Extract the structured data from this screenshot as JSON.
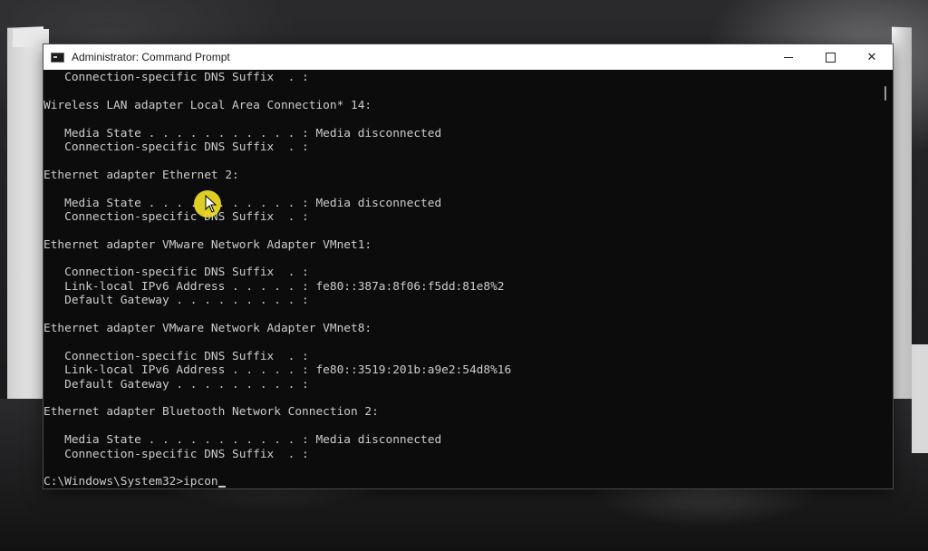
{
  "window": {
    "title": "Administrator: Command Prompt",
    "app_icon": "cmd-icon",
    "controls": {
      "minimize_icon": "minimize-icon",
      "maximize_icon": "maximize-icon",
      "close_glyph": "✕"
    }
  },
  "console": {
    "lines": [
      "   Connection-specific DNS Suffix  . :",
      "",
      "Wireless LAN adapter Local Area Connection* 14:",
      "",
      "   Media State . . . . . . . . . . . : Media disconnected",
      "   Connection-specific DNS Suffix  . :",
      "",
      "Ethernet adapter Ethernet 2:",
      "",
      "   Media State . . . . . . . . . . . : Media disconnected",
      "   Connection-specific DNS Suffix  . :",
      "",
      "Ethernet adapter VMware Network Adapter VMnet1:",
      "",
      "   Connection-specific DNS Suffix  . :",
      "   Link-local IPv6 Address . . . . . : fe80::387a:8f06:f5dd:81e8%2",
      "   Default Gateway . . . . . . . . . :",
      "",
      "Ethernet adapter VMware Network Adapter VMnet8:",
      "",
      "   Connection-specific DNS Suffix  . :",
      "   Link-local IPv6 Address . . . . . : fe80::3519:201b:a9e2:54d8%16",
      "   Default Gateway . . . . . . . . . :",
      "",
      "Ethernet adapter Bluetooth Network Connection 2:",
      "",
      "   Media State . . . . . . . . . . . : Media disconnected",
      "   Connection-specific DNS Suffix  . :",
      ""
    ],
    "prompt": "C:\\Windows\\System32>",
    "typed_input": "ipcon"
  },
  "colors": {
    "console_bg": "#0c0c0c",
    "console_text": "#cccccc",
    "titlebar_bg": "#ffffff",
    "pointer_highlight": "#f0de28"
  }
}
